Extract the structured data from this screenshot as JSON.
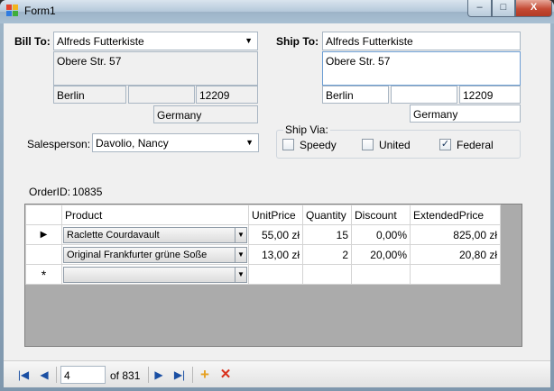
{
  "window": {
    "title": "Form1",
    "minimize": "–",
    "maximize": "□",
    "close": "X"
  },
  "colors": {
    "accent": "#1a4fa3",
    "delete": "#d9301c",
    "add": "#e6a020"
  },
  "bill_to": {
    "label": "Bill To:",
    "name": "Alfreds Futterkiste",
    "address": "Obere Str. 57",
    "city": "Berlin",
    "region": "",
    "postal": "12209",
    "country": "Germany"
  },
  "ship_to": {
    "label": "Ship To:",
    "name": "Alfreds Futterkiste",
    "address": "Obere Str. 57",
    "city": "Berlin",
    "region": "",
    "postal": "12209",
    "country": "Germany"
  },
  "salesperson": {
    "label": "Salesperson:",
    "value": "Davolio, Nancy"
  },
  "ship_via": {
    "title": "Ship Via:",
    "options": [
      {
        "label": "Speedy",
        "checked": false
      },
      {
        "label": "United",
        "checked": false
      },
      {
        "label": "Federal",
        "checked": true
      }
    ]
  },
  "order": {
    "label": "OrderID:",
    "id": "10835"
  },
  "grid": {
    "columns": [
      "Product",
      "UnitPrice",
      "Quantity",
      "Discount",
      "ExtendedPrice"
    ],
    "rows": [
      {
        "marker": "▶",
        "product": "Raclette Courdavault",
        "unit_price": "55,00 zł",
        "quantity": "15",
        "discount": "0,00%",
        "extended": "825,00 zł"
      },
      {
        "marker": "",
        "product": "Original Frankfurter grüne Soße",
        "unit_price": "13,00 zł",
        "quantity": "2",
        "discount": "20,00%",
        "extended": "20,80 zł"
      }
    ],
    "new_row_marker": "*"
  },
  "navigator": {
    "position": "4",
    "count_label": "of 831"
  }
}
